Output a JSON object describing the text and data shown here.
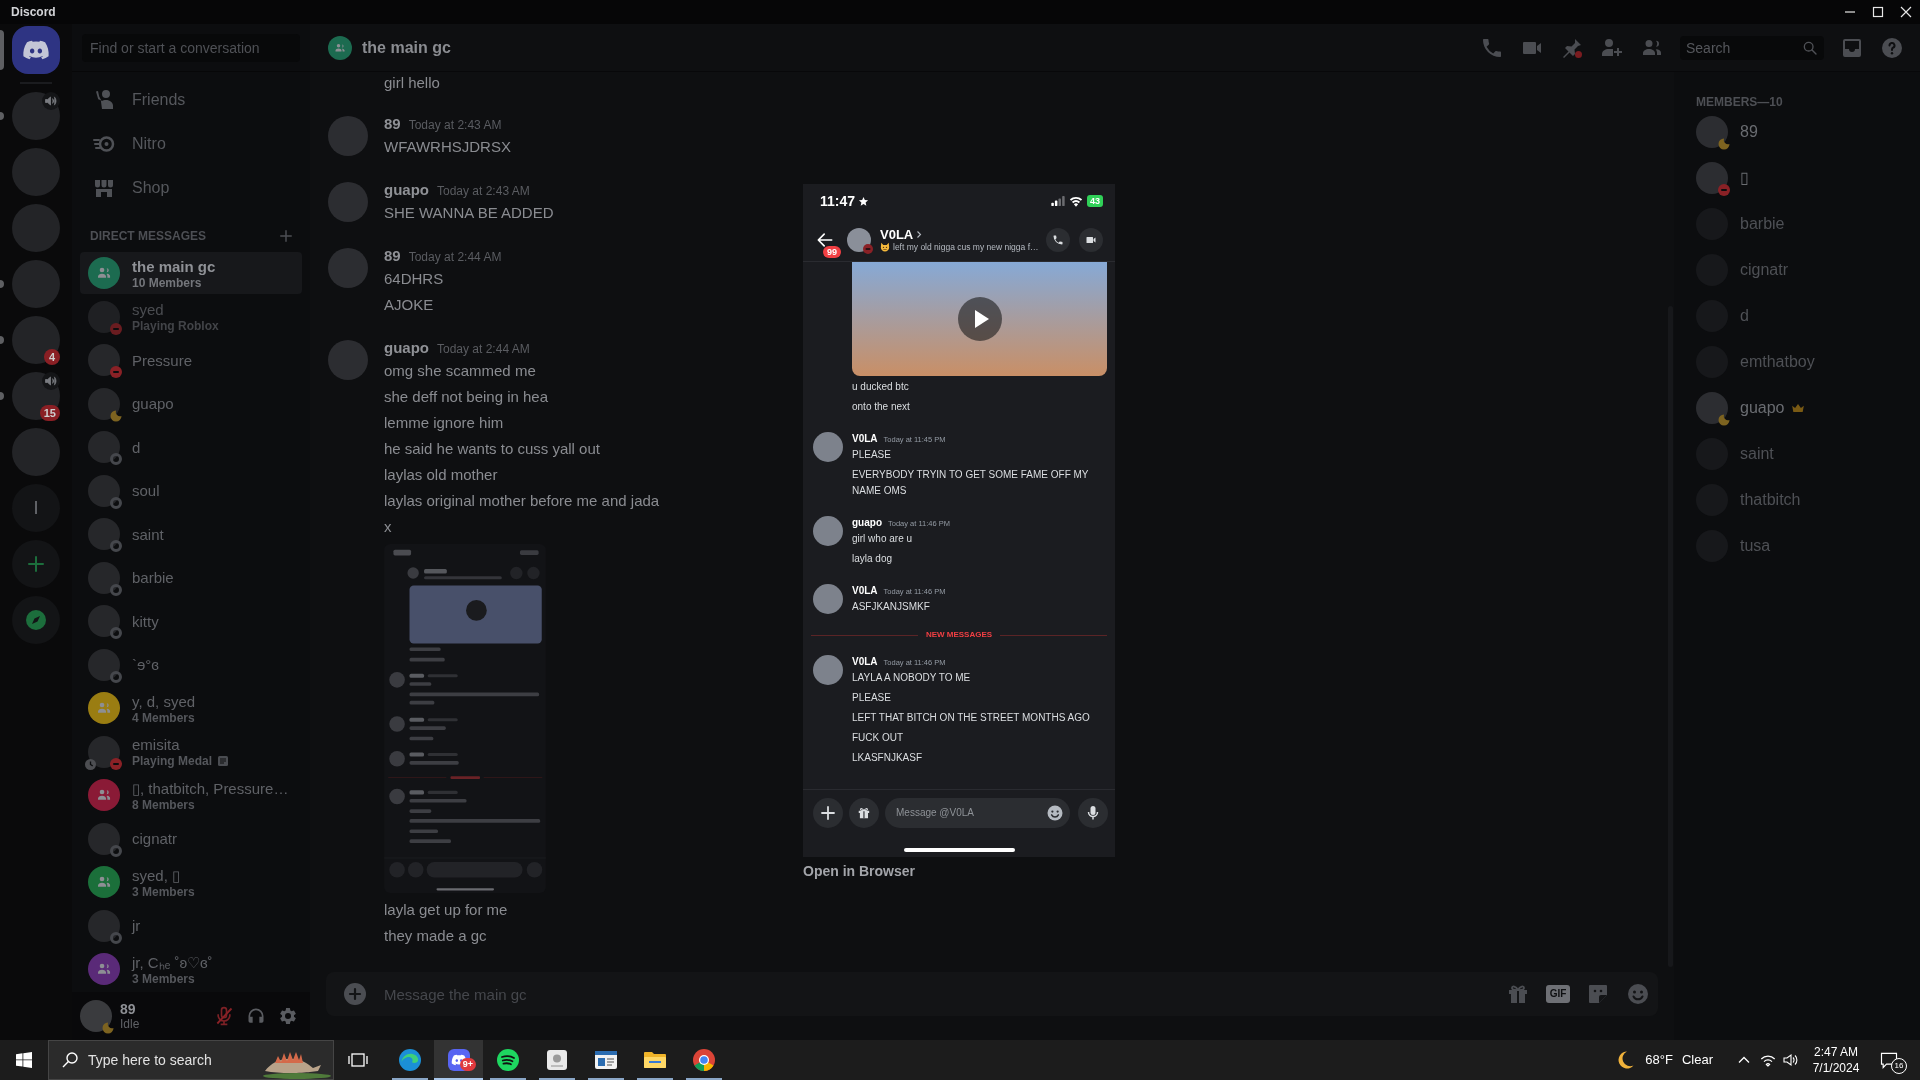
{
  "app": {
    "title": "Discord"
  },
  "servers": [
    {
      "kind": "home",
      "selected": true,
      "unread": false,
      "voice": false
    },
    {
      "kind": "image",
      "selected": false,
      "unread": true,
      "voice": true
    },
    {
      "kind": "image",
      "selected": false,
      "unread": false,
      "voice": false
    },
    {
      "kind": "image",
      "selected": false,
      "unread": false,
      "voice": false
    },
    {
      "kind": "image",
      "selected": false,
      "unread": true,
      "voice": false
    },
    {
      "kind": "image",
      "selected": false,
      "unread": true,
      "voice": false,
      "badge": "4"
    },
    {
      "kind": "image",
      "selected": false,
      "unread": true,
      "voice": true,
      "badge": "15"
    },
    {
      "kind": "image",
      "selected": false,
      "unread": false,
      "voice": false
    },
    {
      "kind": "text",
      "label": "l",
      "selected": false,
      "unread": false,
      "voice": false
    },
    {
      "kind": "add",
      "selected": false,
      "unread": false,
      "voice": false
    },
    {
      "kind": "discover",
      "selected": false,
      "unread": false,
      "voice": false
    }
  ],
  "dm_sidebar": {
    "search": {
      "placeholder": "Find or start a conversation"
    },
    "nav": [
      {
        "kind": "friends",
        "label": "Friends"
      },
      {
        "kind": "nitro",
        "label": "Nitro"
      },
      {
        "kind": "shop",
        "label": "Shop"
      }
    ],
    "section_title": "DIRECT MESSAGES",
    "conversations": [
      {
        "kind": "group",
        "name": "the main gc",
        "subtitle": "10 Members",
        "color": "#1c6b50",
        "selected": true,
        "faded": false
      },
      {
        "kind": "user",
        "name": "syed",
        "subtitle": "Playing Roblox",
        "status": {
          "kind": "dnd"
        },
        "activity": false,
        "selected": false,
        "faded": true
      },
      {
        "kind": "user",
        "name": "Pressure",
        "status": {
          "kind": "dnd"
        },
        "activity": false,
        "selected": false,
        "faded": false
      },
      {
        "kind": "user",
        "name": "guapo",
        "status": {
          "kind": "idle"
        },
        "activity": false,
        "selected": false,
        "faded": false
      },
      {
        "kind": "user",
        "name": "d",
        "status": {
          "kind": "offline"
        },
        "activity": false,
        "selected": false,
        "faded": false
      },
      {
        "kind": "user",
        "name": "soul",
        "status": {
          "kind": "offline"
        },
        "activity": false,
        "selected": false,
        "faded": false
      },
      {
        "kind": "user",
        "name": "saint",
        "status": {
          "kind": "offline"
        },
        "activity": false,
        "selected": false,
        "faded": false
      },
      {
        "kind": "user",
        "name": "barbie",
        "status": {
          "kind": "offline"
        },
        "activity": false,
        "selected": false,
        "faded": false
      },
      {
        "kind": "user",
        "name": "kitty",
        "status": {
          "kind": "offline"
        },
        "activity": false,
        "selected": false,
        "faded": false
      },
      {
        "kind": "user",
        "name": "`ɘ°ɞ",
        "status": {
          "kind": "offline"
        },
        "activity": false,
        "selected": false,
        "faded": false
      },
      {
        "kind": "group",
        "name": "y, d, syed",
        "subtitle": "4 Members",
        "color": "#9a7d12",
        "selected": false,
        "faded": false
      },
      {
        "kind": "user",
        "name": "emisita",
        "subtitle": "Playing Medal",
        "status": {
          "kind": "dnd"
        },
        "activity": true,
        "selected": false,
        "faded": false
      },
      {
        "kind": "group",
        "name": "▯, thatbitch, Pressure…",
        "subtitle": "8 Members",
        "color": "#8a1a36",
        "selected": false,
        "faded": false
      },
      {
        "kind": "user",
        "name": "cignatr",
        "status": {
          "kind": "offline"
        },
        "activity": false,
        "selected": false,
        "faded": false
      },
      {
        "kind": "group",
        "name": "syed, ▯",
        "subtitle": "3 Members",
        "color": "#1b6f3a",
        "selected": false,
        "faded": false
      },
      {
        "kind": "user",
        "name": "jr",
        "status": {
          "kind": "offline"
        },
        "activity": false,
        "selected": false,
        "faded": false
      },
      {
        "kind": "group",
        "name": "jr, Cₕₑ ˚ʚ♡ɞ˚",
        "subtitle": "3 Members",
        "color": "#5a2a78",
        "selected": false,
        "faded": false
      }
    ]
  },
  "user_panel": {
    "name": "89",
    "status_text": "Idle",
    "status": {
      "kind": "idle"
    },
    "mic_muted": true
  },
  "chat": {
    "title": "the main gc",
    "color": "#1c6b50",
    "search": {
      "placeholder": "Search"
    },
    "messages": [
      {
        "kind": "continuation",
        "blocks": [
          {
            "kind": "text",
            "text": "girl hello"
          }
        ]
      },
      {
        "kind": "group",
        "author": "89",
        "time": "Today at 2:43 AM",
        "blocks": [
          {
            "kind": "text",
            "text": "WFAWRHSJDRSX"
          }
        ]
      },
      {
        "kind": "group",
        "author": "guapo",
        "time": "Today at 2:43 AM",
        "blocks": [
          {
            "kind": "text",
            "text": "SHE WANNA BE ADDED"
          }
        ]
      },
      {
        "kind": "group",
        "author": "89",
        "time": "Today at 2:44 AM",
        "blocks": [
          {
            "kind": "text",
            "text": "64DHRS"
          },
          {
            "kind": "text",
            "text": "AJOKE"
          }
        ]
      },
      {
        "kind": "group",
        "author": "guapo",
        "time": "Today at 2:44 AM",
        "blocks": [
          {
            "kind": "text",
            "text": "omg she scammed me"
          },
          {
            "kind": "text",
            "text": "she deff not being in hea"
          },
          {
            "kind": "text",
            "text": "lemme ignore him"
          },
          {
            "kind": "text",
            "text": "he said he wants to cuss yall out"
          },
          {
            "kind": "text",
            "text": "laylas old mother"
          },
          {
            "kind": "text",
            "text": "laylas original mother before me and jada"
          },
          {
            "kind": "text",
            "text": "x"
          },
          {
            "kind": "image"
          },
          {
            "kind": "text",
            "text": "layla get up for me"
          },
          {
            "kind": "text",
            "text": "they made a gc"
          }
        ]
      }
    ],
    "input": {
      "placeholder": "Message the main gc",
      "gif_label": "GIF"
    }
  },
  "members": {
    "title": "MEMBERS—10",
    "items": [
      {
        "name": "89",
        "status": {
          "kind": "idle"
        },
        "owner": false
      },
      {
        "name": "▯",
        "status": {
          "kind": "dnd"
        },
        "owner": false
      },
      {
        "name": "barbie",
        "status": {
          "kind": "offline"
        },
        "owner": false
      },
      {
        "name": "cignatr",
        "status": {
          "kind": "offline"
        },
        "owner": false
      },
      {
        "name": "d",
        "status": {
          "kind": "offline"
        },
        "owner": false
      },
      {
        "name": "emthatboy",
        "status": {
          "kind": "offline"
        },
        "owner": false
      },
      {
        "name": "guapo",
        "status": {
          "kind": "idle"
        },
        "owner": true
      },
      {
        "name": "saint",
        "status": {
          "kind": "offline"
        },
        "owner": false
      },
      {
        "name": "thatbitch",
        "status": {
          "kind": "offline"
        },
        "owner": false
      },
      {
        "name": "tusa",
        "status": {
          "kind": "offline"
        },
        "owner": false
      }
    ]
  },
  "viewer": {
    "phone": {
      "time": "11:47",
      "battery": "43",
      "contact": {
        "name": "V0LA",
        "status": "left my old nigga cus my new nigga f…",
        "badge": "99",
        "presence": {
          "kind": "dnd"
        }
      },
      "messages": [
        {
          "kind": "continuation",
          "blocks": [
            {
              "kind": "video"
            },
            {
              "kind": "text",
              "text": "u ducked btc"
            },
            {
              "kind": "text",
              "text": "onto the next"
            }
          ]
        },
        {
          "kind": "group",
          "author": "V0LA",
          "time": "Today at 11:45 PM",
          "blocks": [
            {
              "kind": "text",
              "text": "PLEASE"
            },
            {
              "kind": "text",
              "text": "EVERYBODY TRYIN TO GET SOME FAME OFF MY NAME OMS"
            }
          ]
        },
        {
          "kind": "group",
          "author": "guapo",
          "time": "Today at 11:46 PM",
          "blocks": [
            {
              "kind": "text",
              "text": "girl who are u"
            },
            {
              "kind": "text",
              "text": "layla dog"
            }
          ]
        },
        {
          "kind": "group",
          "author": "V0LA",
          "time": "Today at 11:46 PM",
          "blocks": [
            {
              "kind": "text",
              "text": "ASFJKANJSMKF"
            }
          ]
        },
        {
          "kind": "divider",
          "label": "NEW MESSAGES"
        },
        {
          "kind": "group",
          "author": "V0LA",
          "time": "Today at 11:46 PM",
          "blocks": [
            {
              "kind": "text",
              "text": "LAYLA A NOBODY TO ME"
            },
            {
              "kind": "text",
              "text": "PLEASE"
            },
            {
              "kind": "text",
              "text": "LEFT THAT BITCH ON THE STREET MONTHS AGO"
            },
            {
              "kind": "text",
              "text": "FUCK OUT"
            },
            {
              "kind": "text",
              "text": "LKASFNJKASF"
            }
          ]
        }
      ],
      "input": {
        "placeholder": "Message @V0LA"
      }
    },
    "link": "Open in Browser"
  },
  "taskbar": {
    "search": {
      "placeholder": "Type here to search"
    },
    "apps": [
      {
        "kind": "swirl",
        "selected": false
      },
      {
        "kind": "controller",
        "selected": true,
        "badge": "9+"
      },
      {
        "kind": "waves",
        "selected": false
      },
      {
        "kind": "tile",
        "selected": false
      },
      {
        "kind": "window",
        "selected": false
      },
      {
        "kind": "folder",
        "selected": false
      },
      {
        "kind": "wheel",
        "selected": false
      }
    ],
    "weather": {
      "temperature": "68°F",
      "condition": "Clear"
    },
    "time": "2:47 AM",
    "date": "7/1/2024",
    "notifications": "16"
  }
}
